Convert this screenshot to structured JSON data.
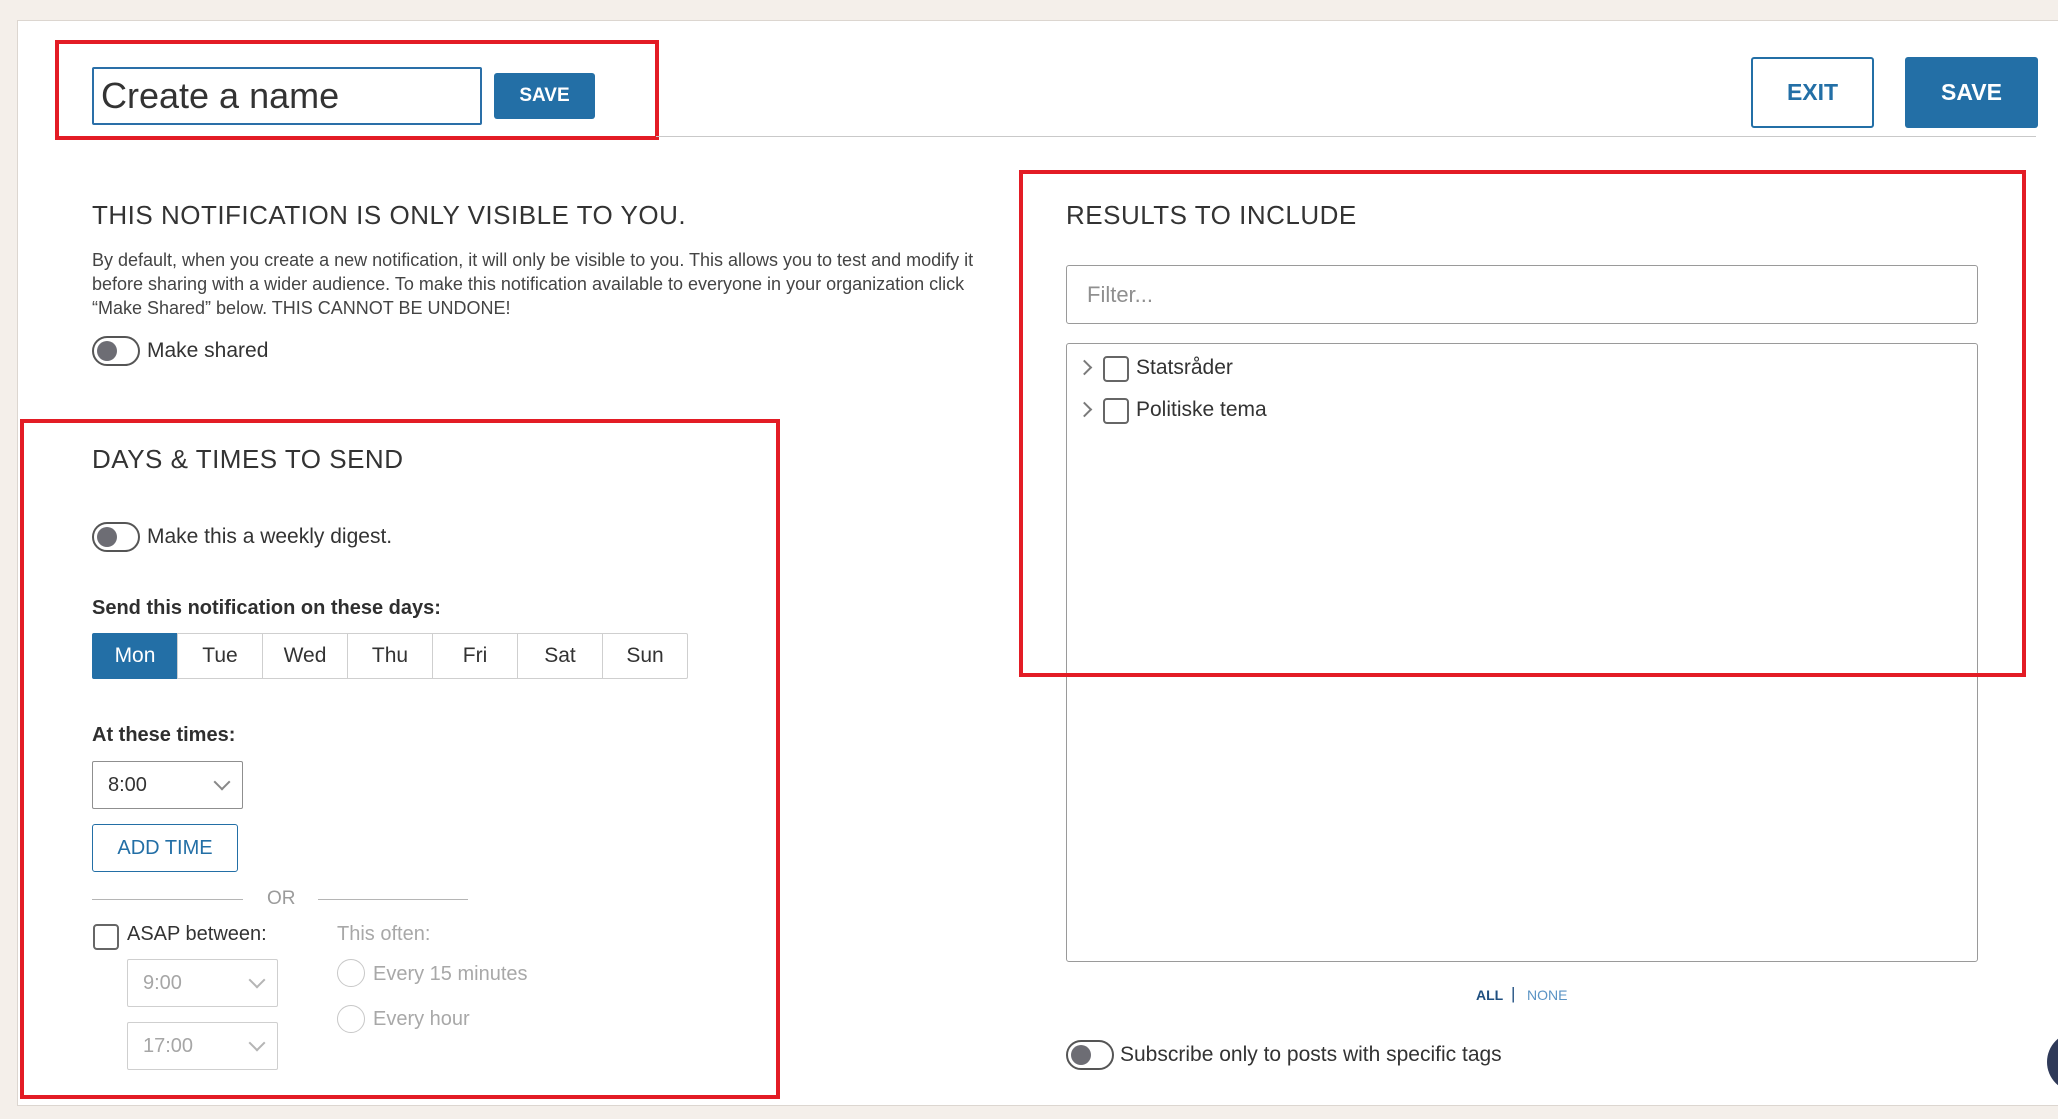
{
  "header": {
    "name_value": "Create a name",
    "name_save_label": "SAVE",
    "exit_label": "EXIT",
    "save_label": "SAVE"
  },
  "visibility": {
    "heading": "THIS NOTIFICATION IS ONLY VISIBLE TO YOU.",
    "line1": "By default, when you create a new notification, it will only be visible to you. This allows you to test and modify it",
    "line2": "before sharing with a wider audience. To make this notification available to everyone in your organization click",
    "line3": "“Make Shared” below. THIS CANNOT BE UNDONE!",
    "make_shared_label": "Make shared"
  },
  "schedule": {
    "heading": "DAYS & TIMES TO SEND",
    "weekly_digest_label": "Make this a weekly digest.",
    "days_label": "Send this notification on these days:",
    "days": [
      "Mon",
      "Tue",
      "Wed",
      "Thu",
      "Fri",
      "Sat",
      "Sun"
    ],
    "active_day": "Mon",
    "times_label": "At these times:",
    "time_value": "8:00",
    "add_time_label": "ADD TIME",
    "or_label": "OR",
    "asap_label": "ASAP between:",
    "asap_start": "9:00",
    "asap_end": "17:00",
    "often_label": "This often:",
    "often_options": [
      "Every 15 minutes",
      "Every hour"
    ]
  },
  "results": {
    "heading": "RESULTS TO INCLUDE",
    "filter_placeholder": "Filter...",
    "tree_items": [
      "Statsråder",
      "Politiske tema"
    ],
    "all_label": "ALL",
    "separator": "|",
    "none_label": "NONE",
    "subscribe_label": "Subscribe only to posts with specific tags"
  },
  "colors": {
    "accent": "#236fa6",
    "highlight_box": "#e31c25",
    "background": "#f4efea"
  }
}
